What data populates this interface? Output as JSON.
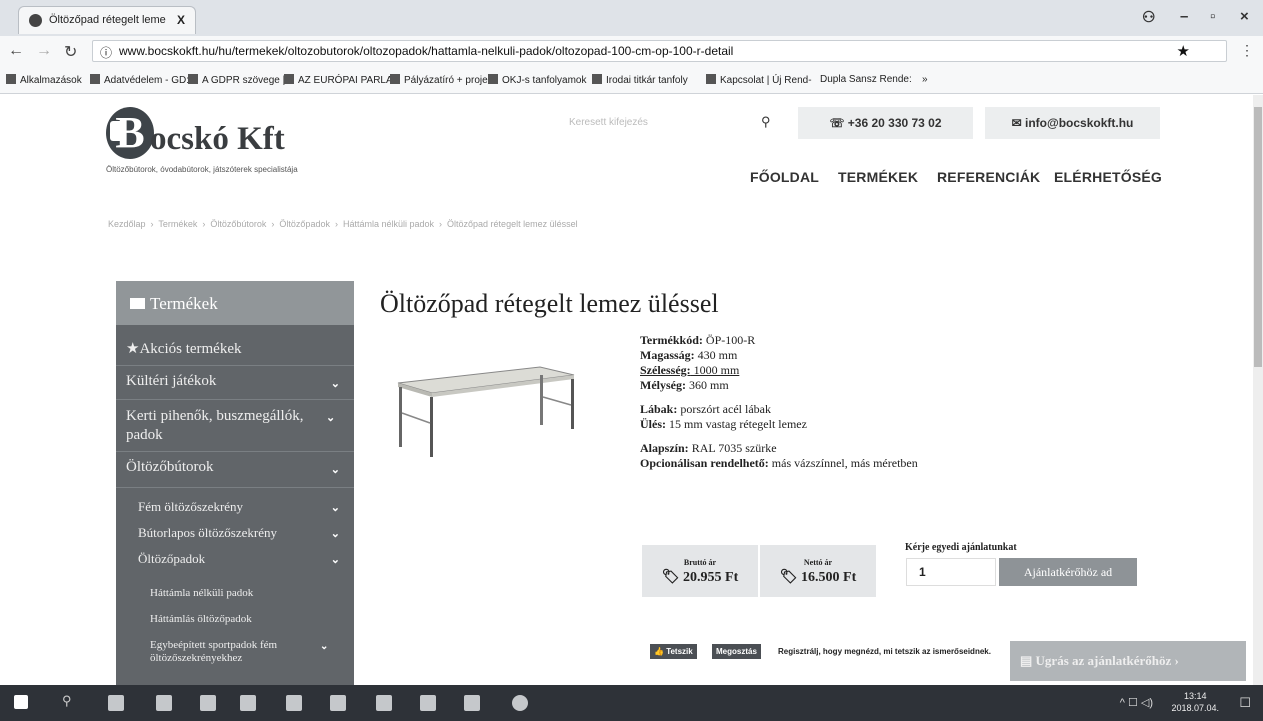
{
  "browser": {
    "tab_title": "Öltözőpad rétegelt leme",
    "tab_close": "X",
    "url": "www.bocskokft.hu/hu/termekek/oltozobutorok/oltozopadok/hattamla-nelkuli-padok/oltozopad-100-cm-op-100-r-detail",
    "win_min": "–",
    "win_max": "▫",
    "win_close": "×",
    "bookmarks": [
      "Alkalmazások",
      "Adatvédelem - GD:",
      "A GDPR szövege | A",
      "AZ EURÓPAI PARLA",
      "Pályázatíró + proje",
      "OKJ-s tanfolyamok",
      "Irodai titkár tanfoly",
      "Kapcsolat | Új Rend-",
      "Dupla Sansz Rende:",
      "»"
    ]
  },
  "header": {
    "logo_letter": "B",
    "logo_text": "ocskó Kft",
    "logo_sub": "Öltözőbútorok, óvodabútorok, játszóterek specialistája",
    "search_placeholder": "Keresett kifejezés",
    "phone": "☏ +36 20 330 73 02",
    "email": "✉ info@bocskokft.hu",
    "nav": [
      "FŐOLDAL",
      "TERMÉKEK",
      "REFERENCIÁK",
      "ELÉRHETŐSÉG"
    ]
  },
  "breadcrumb": [
    "Kezdőlap",
    "Termékek",
    "Öltözőbútorok",
    "Öltözőpadok",
    "Háttámla nélküli padok",
    "Öltözőpad rétegelt lemez üléssel"
  ],
  "sidebar": {
    "title": "Termékek",
    "items": [
      {
        "label": "★Akciós termékek"
      },
      {
        "label": "Kültéri játékok"
      },
      {
        "label": "Kerti pihenők, buszmegállók, padok"
      },
      {
        "label": "Öltözőbútorok"
      },
      {
        "label": "Fém öltözőszekrény"
      },
      {
        "label": "Bútorlapos öltözőszekrény"
      },
      {
        "label": "Öltözőpadok"
      },
      {
        "label": "Háttámla nélküli padok"
      },
      {
        "label": "Háttámlás öltözőpadok"
      },
      {
        "label": "Egybeépített sportpadok fém öltözőszekrényekhez"
      }
    ]
  },
  "product": {
    "title": "Öltözőpad rétegelt lemez üléssel",
    "specs": [
      {
        "k": "Termékkód:",
        "v": " ÖP-100-R"
      },
      {
        "k": "Magasság:",
        "v": " 430 mm"
      },
      {
        "k": "Szélesség:",
        "v": " 1000 mm"
      },
      {
        "k": "Mélység:",
        "v": " 360 mm"
      },
      {
        "k": "Lábak:",
        "v": " porszórt acél lábak"
      },
      {
        "k": "Ülés:",
        "v": " 15 mm vastag rétegelt lemez"
      },
      {
        "k": "Alapszín:",
        "v": " RAL 7035 szürke"
      },
      {
        "k": "Opcionálisan rendelhető:",
        "v": " más vázszínnel, más méretben"
      }
    ],
    "gross_label": "Bruttó ár",
    "gross_price": "20.955 Ft",
    "net_label": "Nettó ár",
    "net_price": "16.500 Ft",
    "offer_label": "Kérje egyedi ajánlatunkat",
    "quantity": "1",
    "add_button": "Ajánlatkérőhöz ad",
    "like_button": "Tetszik",
    "share_button": "Megosztás",
    "social_text": "Regisztrálj, hogy megnézd, mi tetszik az ismerőseidnek.",
    "jump_button": "Ugrás az ajánlatkérőhöz ›"
  },
  "taskbar": {
    "time": "13:14",
    "date": "2018.07.04."
  }
}
